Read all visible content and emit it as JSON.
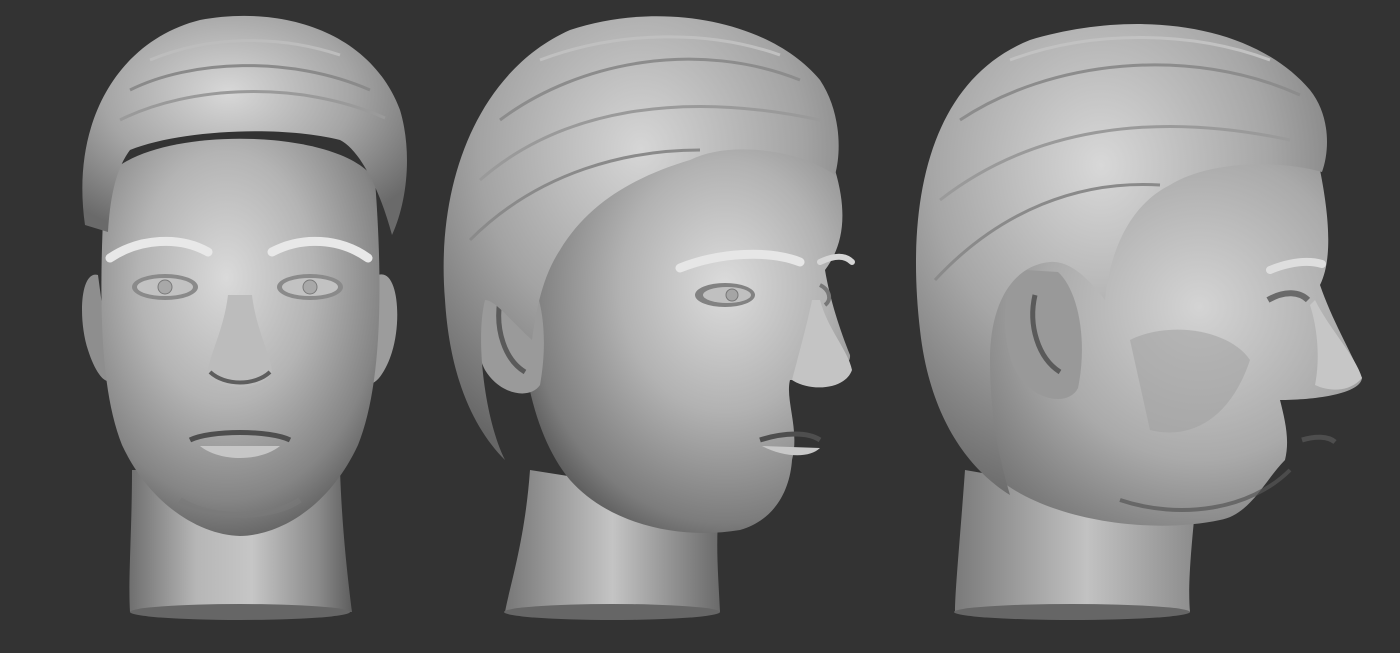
{
  "scene": {
    "background_color": "#333333",
    "clay_base_color": "#a3a3a3",
    "clay_light_color": "#e2e2e2",
    "clay_shadow_color": "#3c3c3c",
    "views": [
      {
        "view": "front"
      },
      {
        "view": "three-quarter"
      },
      {
        "view": "profile"
      }
    ]
  }
}
